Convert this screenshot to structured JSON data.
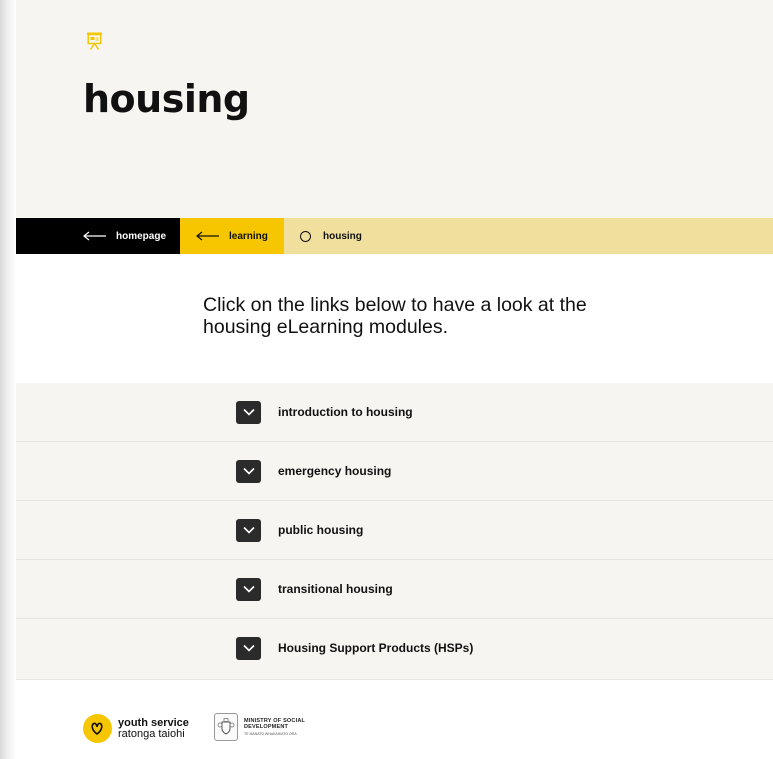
{
  "hero": {
    "icon": "presentation-board-icon",
    "title": "housing"
  },
  "breadcrumb": {
    "home": "homepage",
    "learning": "learning",
    "current": "housing"
  },
  "intro": "Click on the links below to have a look at the housing eLearning modules.",
  "accordion": {
    "items": [
      {
        "label": "introduction to housing"
      },
      {
        "label": "emergency housing"
      },
      {
        "label": "public housing"
      },
      {
        "label": "transitional housing"
      },
      {
        "label": "Housing Support Products (HSPs)"
      }
    ]
  },
  "footer": {
    "youth_service": {
      "name": "youth service",
      "sub": "ratonga taiohi"
    },
    "msd": {
      "line1": "MINISTRY OF SOCIAL",
      "line2": "DEVELOPMENT",
      "sub": "TE MANATŪ WHAKAHIATO ORA"
    }
  },
  "colors": {
    "accent_yellow": "#f6c700",
    "breadcrumb_bg": "#f1df9e",
    "hero_bg": "#f7f5f1",
    "dark": "#2b2b2b"
  }
}
